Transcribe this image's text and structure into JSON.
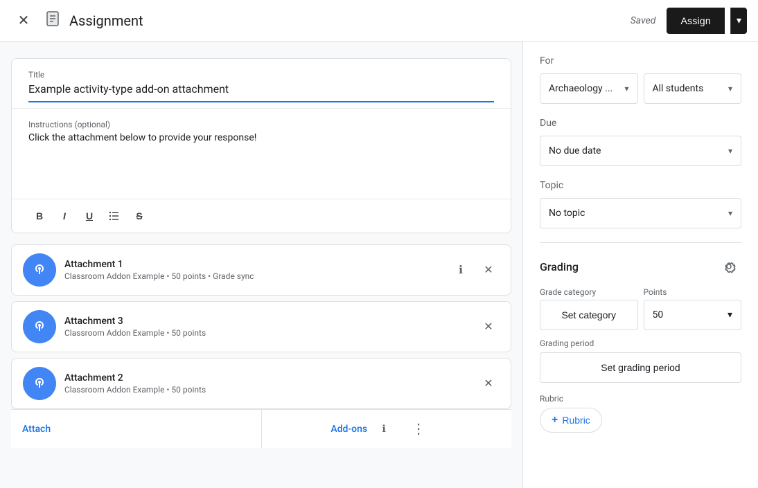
{
  "header": {
    "title": "Assignment",
    "saved_text": "Saved",
    "assign_label": "Assign",
    "close_icon": "✕",
    "dropdown_icon": "▾"
  },
  "assignment": {
    "title_label": "Title",
    "title_value": "Example activity-type add-on attachment",
    "instructions_label": "Instructions (optional)",
    "instructions_value": "Click the attachment below to provide your response!",
    "toolbar": {
      "bold": "B",
      "italic": "I",
      "underline": "U",
      "list": "☰",
      "strikethrough": "S"
    }
  },
  "attachments": [
    {
      "name": "Attachment 1",
      "meta": "Classroom Addon Example • 50 points • Grade sync"
    },
    {
      "name": "Attachment 3",
      "meta": "Classroom Addon Example • 50 points"
    },
    {
      "name": "Attachment 2",
      "meta": "Classroom Addon Example • 50 points"
    }
  ],
  "bottom_bar": {
    "attach_label": "Attach",
    "addons_label": "Add-ons",
    "info_icon": "ℹ",
    "more_icon": "⋮"
  },
  "right_panel": {
    "for_label": "For",
    "class_value": "Archaeology ...",
    "students_value": "All students",
    "due_label": "Due",
    "due_value": "No due date",
    "topic_label": "Topic",
    "topic_value": "No topic",
    "grading_title": "Grading",
    "grade_category_label": "Grade category",
    "points_label": "Points",
    "set_category_label": "Set category",
    "points_value": "50",
    "grading_period_label": "Grading period",
    "set_grading_label": "Set grading period",
    "rubric_label": "Rubric",
    "rubric_btn_label": "Rubric",
    "chevron": "▾",
    "plus": "+"
  }
}
